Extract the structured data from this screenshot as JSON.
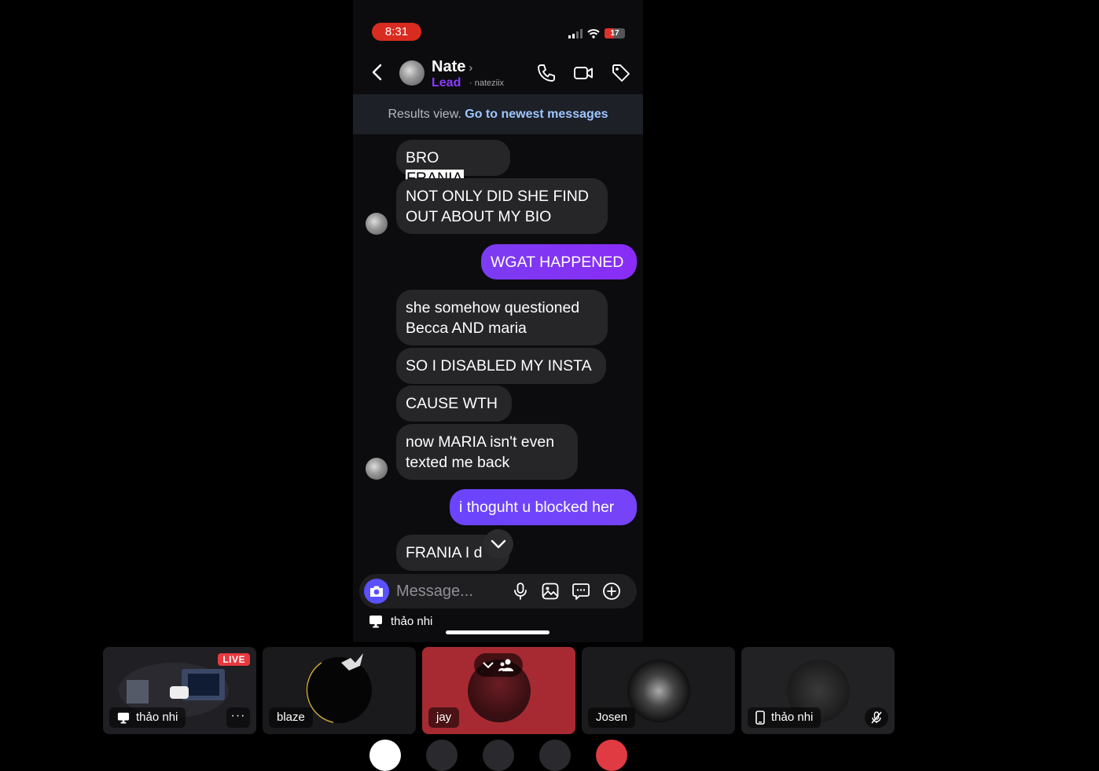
{
  "status_bar": {
    "time": "8:31",
    "battery": "17"
  },
  "chat_header": {
    "name": "Nate",
    "name_chevron": "›",
    "role": "Lead",
    "separator": "·",
    "handle": "nateziix"
  },
  "results_bar": {
    "label": "Results view.",
    "link": "Go to newest messages"
  },
  "messages": [
    {
      "side": "received",
      "pre": "BRO ",
      "highlight": "FRANIA"
    },
    {
      "side": "received",
      "text": "NOT ONLY DID SHE FIND OUT ABOUT MY BIO"
    },
    {
      "side": "sent",
      "text": "WGAT HAPPENED"
    },
    {
      "side": "received",
      "text": "she somehow questioned Becca AND maria"
    },
    {
      "side": "received",
      "text": "SO I DISABLED MY INSTA"
    },
    {
      "side": "received",
      "text": "CAUSE WTH"
    },
    {
      "side": "received",
      "text": "now MARIA isn't even texted me back"
    },
    {
      "side": "sent",
      "text": "i thoguht u blocked her"
    },
    {
      "side": "received",
      "text": "FRANIA I d"
    }
  ],
  "composer": {
    "placeholder": "Message..."
  },
  "presenter": {
    "name": "thảo nhi"
  },
  "participants": [
    {
      "name": "thảo nhi",
      "badge": "LIVE",
      "more": "···",
      "device": "screen"
    },
    {
      "name": "blaze"
    },
    {
      "name": "jay",
      "accent": "#a72a32"
    },
    {
      "name": "Josen"
    },
    {
      "name": "thảo nhi",
      "device": "phone",
      "muted": true
    }
  ]
}
